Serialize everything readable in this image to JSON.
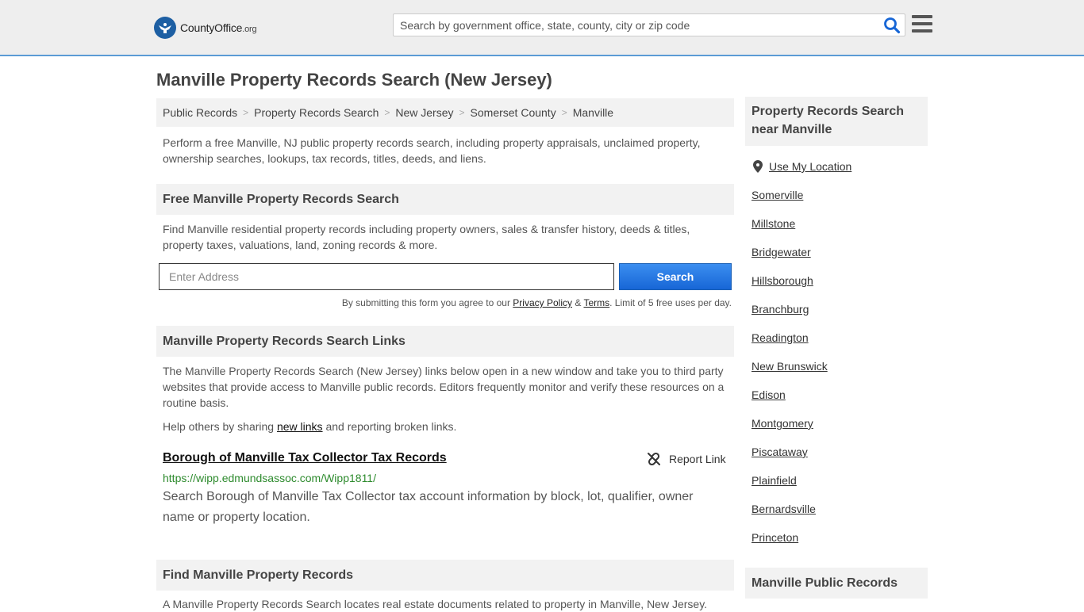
{
  "header": {
    "logo_main": "CountyOffice",
    "logo_tld": ".org",
    "search_placeholder": "Search by government office, state, county, city or zip code"
  },
  "page": {
    "title": "Manville Property Records Search (New Jersey)",
    "breadcrumbs": [
      "Public Records",
      "Property Records Search",
      "New Jersey",
      "Somerset County",
      "Manville"
    ],
    "intro": "Perform a free Manville, NJ public property records search, including property appraisals, unclaimed property, ownership searches, lookups, tax records, titles, deeds, and liens."
  },
  "free_search": {
    "heading": "Free Manville Property Records Search",
    "description": "Find Manville residential property records including property owners, sales & transfer history, deeds & titles, property taxes, valuations, land, zoning records & more.",
    "address_placeholder": "Enter Address",
    "button_label": "Search",
    "terms_prefix": "By submitting this form you agree to our",
    "privacy_label": "Privacy Policy",
    "amp": "&",
    "terms_label": "Terms",
    "terms_suffix": ". Limit of 5 free uses per day."
  },
  "links_section": {
    "heading": "Manville Property Records Search Links",
    "description": "The Manville Property Records Search (New Jersey) links below open in a new window and take you to third party websites that provide access to Manville public records. Editors frequently monitor and verify these resources on a routine basis.",
    "help_prefix": "Help others by sharing",
    "help_link": "new links",
    "help_suffix": "and reporting broken links.",
    "items": [
      {
        "title": "Borough of Manville Tax Collector Tax Records",
        "report_label": "Report Link",
        "url": "https://wipp.edmundsassoc.com/Wipp1811/",
        "description": "Search Borough of Manville Tax Collector tax account information by block, lot, qualifier, owner name or property location."
      }
    ]
  },
  "find_section": {
    "heading": "Find Manville Property Records",
    "description": "A Manville Property Records Search locates real estate documents related to property in Manville, New Jersey."
  },
  "sidebar": {
    "nearby_heading": "Property Records Search near Manville",
    "use_location": "Use My Location",
    "cities": [
      "Somerville",
      "Millstone",
      "Bridgewater",
      "Hillsborough",
      "Branchburg",
      "Readington",
      "New Brunswick",
      "Edison",
      "Montgomery",
      "Piscataway",
      "Plainfield",
      "Bernardsville",
      "Princeton"
    ],
    "public_records_heading": "Manville Public Records"
  },
  "colors": {
    "accent_blue": "#1766d6",
    "url_green": "#2e8b2e",
    "header_bg": "#eeeeee"
  }
}
